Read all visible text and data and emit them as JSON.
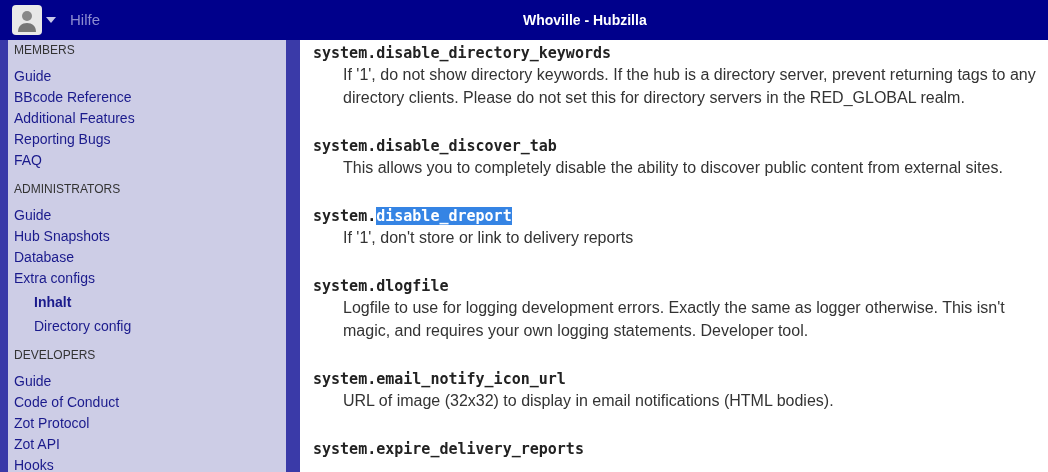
{
  "header": {
    "menu": "Hilfe",
    "title": "Whoville - Hubzilla"
  },
  "sidebar": [
    {
      "heading": "MEMBERS",
      "items": [
        {
          "label": "Guide",
          "selected": false
        },
        {
          "label": "BBcode Reference",
          "selected": false
        },
        {
          "label": "Additional Features",
          "selected": false
        },
        {
          "label": "Reporting Bugs",
          "selected": false
        },
        {
          "label": "FAQ",
          "selected": false
        }
      ]
    },
    {
      "heading": "ADMINISTRATORS",
      "items": [
        {
          "label": "Guide",
          "selected": false
        },
        {
          "label": "Hub Snapshots",
          "selected": false
        },
        {
          "label": "Database",
          "selected": false
        },
        {
          "label": "Extra configs",
          "selected": false,
          "children": [
            {
              "label": "Inhalt",
              "selected": true
            },
            {
              "label": "Directory config",
              "selected": false
            }
          ]
        }
      ]
    },
    {
      "heading": "DEVELOPERS",
      "items": [
        {
          "label": "Guide",
          "selected": false
        },
        {
          "label": "Code of Conduct",
          "selected": false
        },
        {
          "label": "Zot Protocol",
          "selected": false
        },
        {
          "label": "Zot API",
          "selected": false
        },
        {
          "label": "Hooks",
          "selected": false
        }
      ]
    }
  ],
  "settings": [
    {
      "parts": [
        {
          "text": "system.disable_directory_keywords",
          "selected": false
        }
      ],
      "description": "If '1', do not show directory keywords. If the hub is a directory server, prevent returning tags to any directory clients. Please do not set this for directory servers in the RED_GLOBAL realm."
    },
    {
      "parts": [
        {
          "text": "system.disable_discover_tab",
          "selected": false
        }
      ],
      "description": "This allows you to completely disable the ability to discover public content from external sites."
    },
    {
      "parts": [
        {
          "text": "system.",
          "selected": false
        },
        {
          "text": "disable_dreport",
          "selected": true
        }
      ],
      "description": "If '1', don't store or link to delivery reports"
    },
    {
      "parts": [
        {
          "text": "system.dlogfile",
          "selected": false
        }
      ],
      "description": "Logfile to use for logging development errors.  Exactly the same as logger otherwise.  This isn't magic, and requires your own logging statements.  Developer tool."
    },
    {
      "parts": [
        {
          "text": "system.email_notify_icon_url",
          "selected": false
        }
      ],
      "description": "URL of image (32x32) to display in email notifications (HTML bodies)."
    },
    {
      "parts": [
        {
          "text": "system.expire_delivery_reports",
          "selected": false
        }
      ]
    }
  ]
}
